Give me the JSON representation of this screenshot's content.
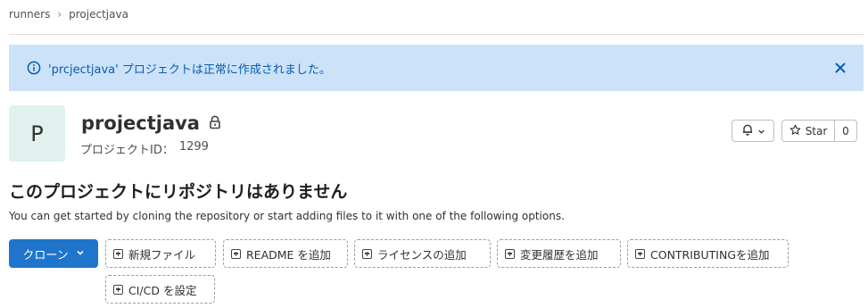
{
  "breadcrumb": {
    "items": [
      "runners",
      "projectjava"
    ]
  },
  "alert": {
    "message": "'prcjectjava' プロジェクトは正常に作成されました。",
    "color": "#cbe2f9",
    "text_color": "#0b5cad",
    "icon": "info-icon",
    "close_icon": "close-icon"
  },
  "project": {
    "avatar_letter": "P",
    "name": "projectjava",
    "visibility_icon": "lock-icon",
    "id_label": "プロジェクトID：",
    "id_value": "1299"
  },
  "actions": {
    "notification_icon": "bell-icon",
    "star_label": "Star",
    "star_count": "0"
  },
  "empty_state": {
    "title": "このプロジェクトにリポジトリはありません",
    "description": "You can get started by cloning the repository or start adding files to it with one of the following options."
  },
  "buttons": {
    "clone_label": "クローン",
    "clone_color": "#1f75cb",
    "new_file": "新規ファイル",
    "add_readme": "README を追加",
    "add_license": "ライセンスの追加",
    "add_changelog": "変更履歴を追加",
    "add_contributing": "CONTRIBUTINGを追加",
    "setup_cicd": "CI/CD を設定"
  }
}
